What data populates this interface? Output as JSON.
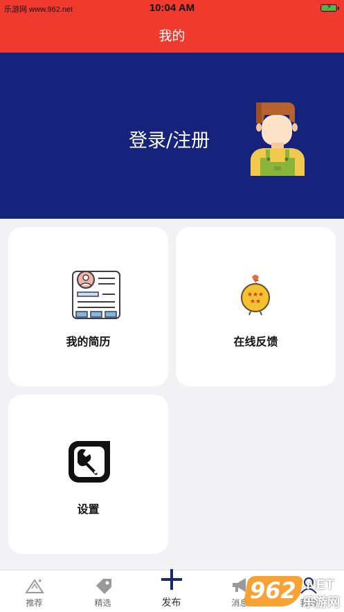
{
  "status_bar": {
    "carrier": "乐游网 www.962.net",
    "time": "10:04 AM"
  },
  "nav": {
    "title": "我的"
  },
  "hero": {
    "login_label": "登录/注册",
    "background_color": "#15237d",
    "avatar_icon": "worker-avatar-icon"
  },
  "cards": [
    {
      "label": "我的简历",
      "icon": "resume-icon"
    },
    {
      "label": "在线反馈",
      "icon": "feedback-badge-icon"
    },
    {
      "label": "设置",
      "icon": "settings-wrench-icon"
    }
  ],
  "tabbar": {
    "tabs": [
      {
        "label": "推荐",
        "icon": "mountain-star-icon"
      },
      {
        "label": "精选",
        "icon": "tag-icon"
      },
      {
        "label": "发布",
        "icon": "plus-icon"
      },
      {
        "label": "消息",
        "icon": "megaphone-icon"
      },
      {
        "label": "我的",
        "icon": "user-icon"
      }
    ]
  },
  "watermark": {
    "text": "962",
    "text2": ".NET",
    "text3": "乐游网"
  },
  "colors": {
    "accent": "#f03a2e",
    "hero": "#15237d",
    "publish": "#1b2a70"
  }
}
